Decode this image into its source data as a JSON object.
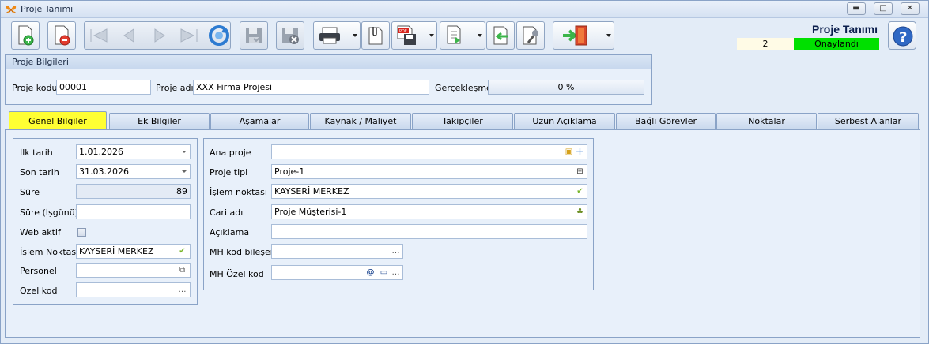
{
  "window": {
    "title": "Proje Tanımı"
  },
  "header": {
    "title": "Proje Tanımı",
    "number": "2",
    "status": "Onaylandı",
    "status_color": "#00e000"
  },
  "toolbar": {
    "buttons": [
      "new-doc",
      "delete-doc",
      "first",
      "prev",
      "next",
      "last",
      "refresh",
      "save",
      "cancel-save",
      "print",
      "attach",
      "pdf-save",
      "export",
      "import",
      "tools",
      "exit"
    ]
  },
  "proje_bilgileri": {
    "heading": "Proje Bilgileri",
    "kod_label": "Proje kodu",
    "kod_value": "00001",
    "adi_label": "Proje adı",
    "adi_value": "XXX Firma Projesi",
    "gerceklesme_label": "Gerçekleşme",
    "gerceklesme_value": "0 %",
    "gerceklesme_fraction": 0
  },
  "tabs": [
    "Genel Bilgiler",
    "Ek Bilgiler",
    "Aşamalar",
    "Kaynak / Maliyet",
    "Takipçiler",
    "Uzun Açıklama",
    "Bağlı Görevler",
    "Noktalar",
    "Serbest Alanlar"
  ],
  "active_tab": "Genel Bilgiler",
  "left": {
    "ilk_tarih_label": "İlk tarih",
    "ilk_tarih": "1.01.2026",
    "son_tarih_label": "Son tarih",
    "son_tarih": "31.03.2026",
    "sure_label": "Süre",
    "sure": "89",
    "sure_isgunu_label": "Süre (İşgünü)",
    "sure_isgunu": "",
    "web_aktif_label": "Web aktif",
    "islem_noktasi_label": "İşlem Noktası",
    "islem_noktasi": "KAYSERİ MERKEZ",
    "personel_label": "Personel",
    "personel": "",
    "ozel_kod_label": "Özel kod",
    "ozel_kod": ""
  },
  "right": {
    "ana_proje_label": "Ana proje",
    "ana_proje": "",
    "proje_tipi_label": "Proje tipi",
    "proje_tipi": "Proje-1",
    "islem_noktasi_label": "İşlem noktası",
    "islem_noktasi": "KAYSERİ MERKEZ",
    "cari_adi_label": "Cari adı",
    "cari_adi": "Proje Müşterisi-1",
    "aciklama_label": "Açıklama",
    "aciklama": "",
    "mh_kod_bileseni_label": "MH kod bileşeni",
    "mh_kod_bileseni": "",
    "mh_ozel_kod_label": "MH Özel kod",
    "mh_ozel_kod": ""
  }
}
